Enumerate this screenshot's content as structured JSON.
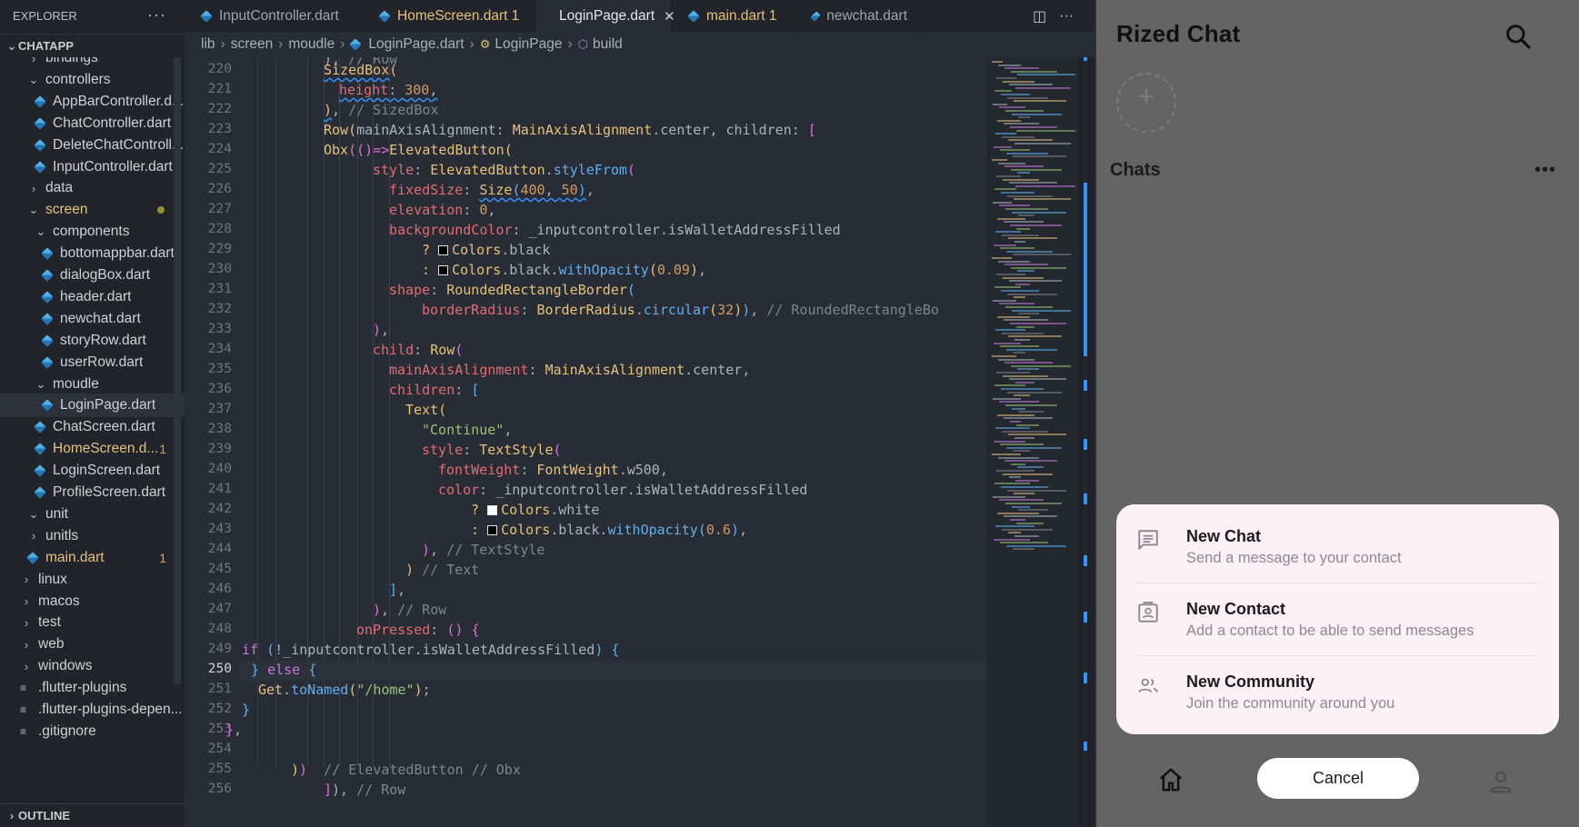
{
  "explorer": {
    "title": "EXPLORER",
    "more": "···",
    "section": "CHATAPP",
    "outline": "OUTLINE",
    "items": [
      {
        "label": "bindings",
        "kind": "folder",
        "depth": 1,
        "open": false
      },
      {
        "label": "controllers",
        "kind": "folder",
        "depth": 1,
        "open": true
      },
      {
        "label": "AppBarController.d...",
        "kind": "dart",
        "depth": 2
      },
      {
        "label": "ChatController.dart",
        "kind": "dart",
        "depth": 2
      },
      {
        "label": "DeleteChatControll...",
        "kind": "dart",
        "depth": 2
      },
      {
        "label": "InputController.dart",
        "kind": "dart",
        "depth": 2
      },
      {
        "label": "data",
        "kind": "folder",
        "depth": 1,
        "open": false
      },
      {
        "label": "screen",
        "kind": "folder",
        "depth": 1,
        "open": true,
        "status": "modified"
      },
      {
        "label": "components",
        "kind": "folder",
        "depth": 2,
        "open": true
      },
      {
        "label": "bottomappbar.dart",
        "kind": "dart",
        "depth": 3
      },
      {
        "label": "dialogBox.dart",
        "kind": "dart",
        "depth": 3
      },
      {
        "label": "header.dart",
        "kind": "dart",
        "depth": 3
      },
      {
        "label": "newchat.dart",
        "kind": "dart",
        "depth": 3
      },
      {
        "label": "storyRow.dart",
        "kind": "dart",
        "depth": 3
      },
      {
        "label": "userRow.dart",
        "kind": "dart",
        "depth": 3
      },
      {
        "label": "moudle",
        "kind": "folder",
        "depth": 2,
        "open": true
      },
      {
        "label": "LoginPage.dart",
        "kind": "dart",
        "depth": 3,
        "selected": true
      },
      {
        "label": "ChatScreen.dart",
        "kind": "dart",
        "depth": 2
      },
      {
        "label": "HomeScreen.d...",
        "kind": "dart",
        "depth": 2,
        "badge": "1"
      },
      {
        "label": "LoginScreen.dart",
        "kind": "dart",
        "depth": 2
      },
      {
        "label": "ProfileScreen.dart",
        "kind": "dart",
        "depth": 2
      },
      {
        "label": "unit",
        "kind": "folder",
        "depth": 1,
        "open": true
      },
      {
        "label": "unitls",
        "kind": "folder",
        "depth": 1,
        "open": false
      },
      {
        "label": "main.dart",
        "kind": "dart",
        "depth": 1,
        "badge": "1"
      },
      {
        "label": "linux",
        "kind": "folder",
        "depth": 0,
        "open": false
      },
      {
        "label": "macos",
        "kind": "folder",
        "depth": 0,
        "open": false
      },
      {
        "label": "test",
        "kind": "folder",
        "depth": 0,
        "open": false
      },
      {
        "label": "web",
        "kind": "folder",
        "depth": 0,
        "open": false
      },
      {
        "label": "windows",
        "kind": "folder",
        "depth": 0,
        "open": false
      },
      {
        "label": ".flutter-plugins",
        "kind": "list",
        "depth": 0
      },
      {
        "label": ".flutter-plugins-depen...",
        "kind": "list",
        "depth": 0
      },
      {
        "label": ".gitignore",
        "kind": "list",
        "depth": 0
      }
    ]
  },
  "tabs": [
    {
      "label": "InputController.dart",
      "modified": false,
      "active": false
    },
    {
      "label": "HomeScreen.dart 1",
      "modified": true,
      "active": false
    },
    {
      "label": "LoginPage.dart",
      "modified": false,
      "active": true
    },
    {
      "label": "main.dart 1",
      "modified": true,
      "active": false
    },
    {
      "label": "newchat.dart",
      "modified": false,
      "active": false
    }
  ],
  "breadcrumb": [
    "lib",
    "screen",
    "moudle",
    "LoginPage.dart",
    "LoginPage",
    "build"
  ],
  "editor": {
    "first_line": 220,
    "current_line": 250,
    "lines": [
      "220",
      "221",
      "222",
      "223",
      "224",
      "225",
      "226",
      "227",
      "228",
      "229",
      "230",
      "231",
      "232",
      "233",
      "234",
      "235",
      "236",
      "237",
      "238",
      "239",
      "240",
      "241",
      "242",
      "243",
      "244",
      "245",
      "246",
      "247",
      "248",
      "249",
      "250",
      "251",
      "252",
      "253",
      "254",
      "255",
      "256"
    ]
  },
  "phone": {
    "app_title": "Rized Chat",
    "add_story": "+",
    "chats_heading": "Chats",
    "more": "•••",
    "options": [
      {
        "title": "New Chat",
        "subtitle": "Send a message to your contact",
        "icon": "message-icon"
      },
      {
        "title": "New Contact",
        "subtitle": "Add a contact to be able to send messages",
        "icon": "contact-icon"
      },
      {
        "title": "New Community",
        "subtitle": "Join the community around you",
        "icon": "community-icon"
      }
    ],
    "cancel_label": "Cancel"
  }
}
